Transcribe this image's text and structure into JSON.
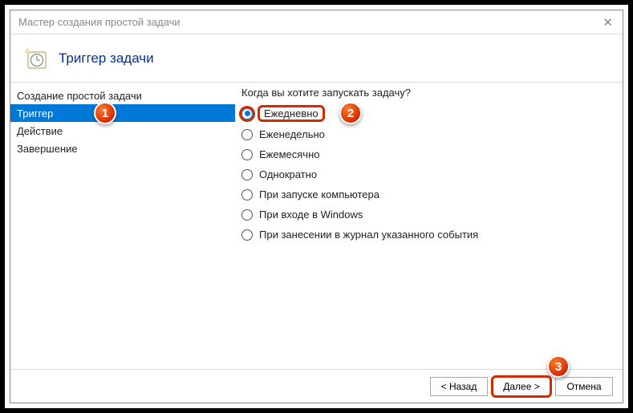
{
  "window": {
    "title": "Мастер создания простой задачи"
  },
  "header": {
    "title": "Триггер задачи"
  },
  "sidebar": {
    "items": [
      {
        "label": "Создание простой задачи",
        "selected": false
      },
      {
        "label": "Триггер",
        "selected": true
      },
      {
        "label": "Действие",
        "selected": false
      },
      {
        "label": "Завершение",
        "selected": false
      }
    ]
  },
  "main": {
    "question": "Когда вы хотите запускать задачу?",
    "options": [
      {
        "label": "Ежедневно",
        "checked": true
      },
      {
        "label": "Еженедельно",
        "checked": false
      },
      {
        "label": "Ежемесячно",
        "checked": false
      },
      {
        "label": "Однократно",
        "checked": false
      },
      {
        "label": "При запуске компьютера",
        "checked": false
      },
      {
        "label": "При входе в Windows",
        "checked": false
      },
      {
        "label": "При занесении в журнал указанного события",
        "checked": false
      }
    ]
  },
  "buttons": {
    "back": "< Назад",
    "next": "Далее >",
    "cancel": "Отмена"
  },
  "callouts": {
    "c1": "1",
    "c2": "2",
    "c3": "3"
  }
}
